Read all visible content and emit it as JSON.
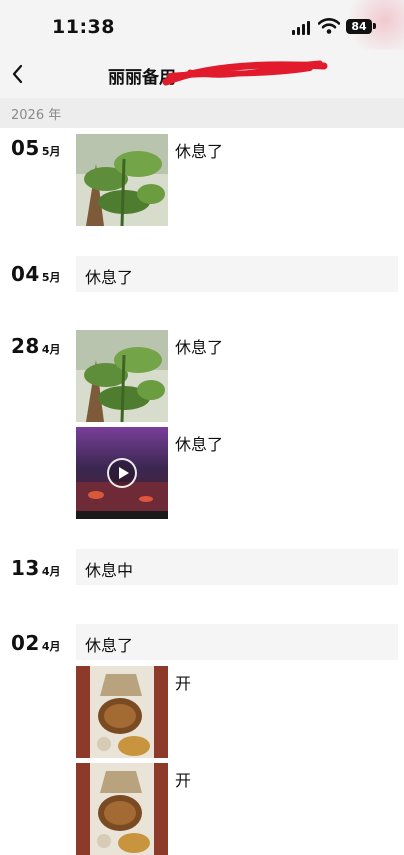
{
  "status": {
    "time": "11:38",
    "battery": "84"
  },
  "nav": {
    "back_icon": "chevron-left-icon",
    "title": "丽丽备用"
  },
  "year": "2026 年",
  "entries": [
    {
      "day": "05",
      "month": "5月",
      "items": [
        {
          "type": "image",
          "subject": "plant",
          "caption": "休息了"
        }
      ]
    },
    {
      "day": "04",
      "month": "5月",
      "text": "休息了"
    },
    {
      "day": "28",
      "month": "4月",
      "items": [
        {
          "type": "image",
          "subject": "plant",
          "caption": "休息了"
        },
        {
          "type": "video",
          "subject": "aquarium",
          "caption": "休息了"
        }
      ]
    },
    {
      "day": "13",
      "month": "4月",
      "text": "休息中"
    },
    {
      "day": "02",
      "month": "4月",
      "text": "休息了",
      "items": [
        {
          "type": "image",
          "subject": "brewing",
          "caption": "开"
        },
        {
          "type": "image",
          "subject": "brewing",
          "caption": "开"
        }
      ]
    }
  ]
}
